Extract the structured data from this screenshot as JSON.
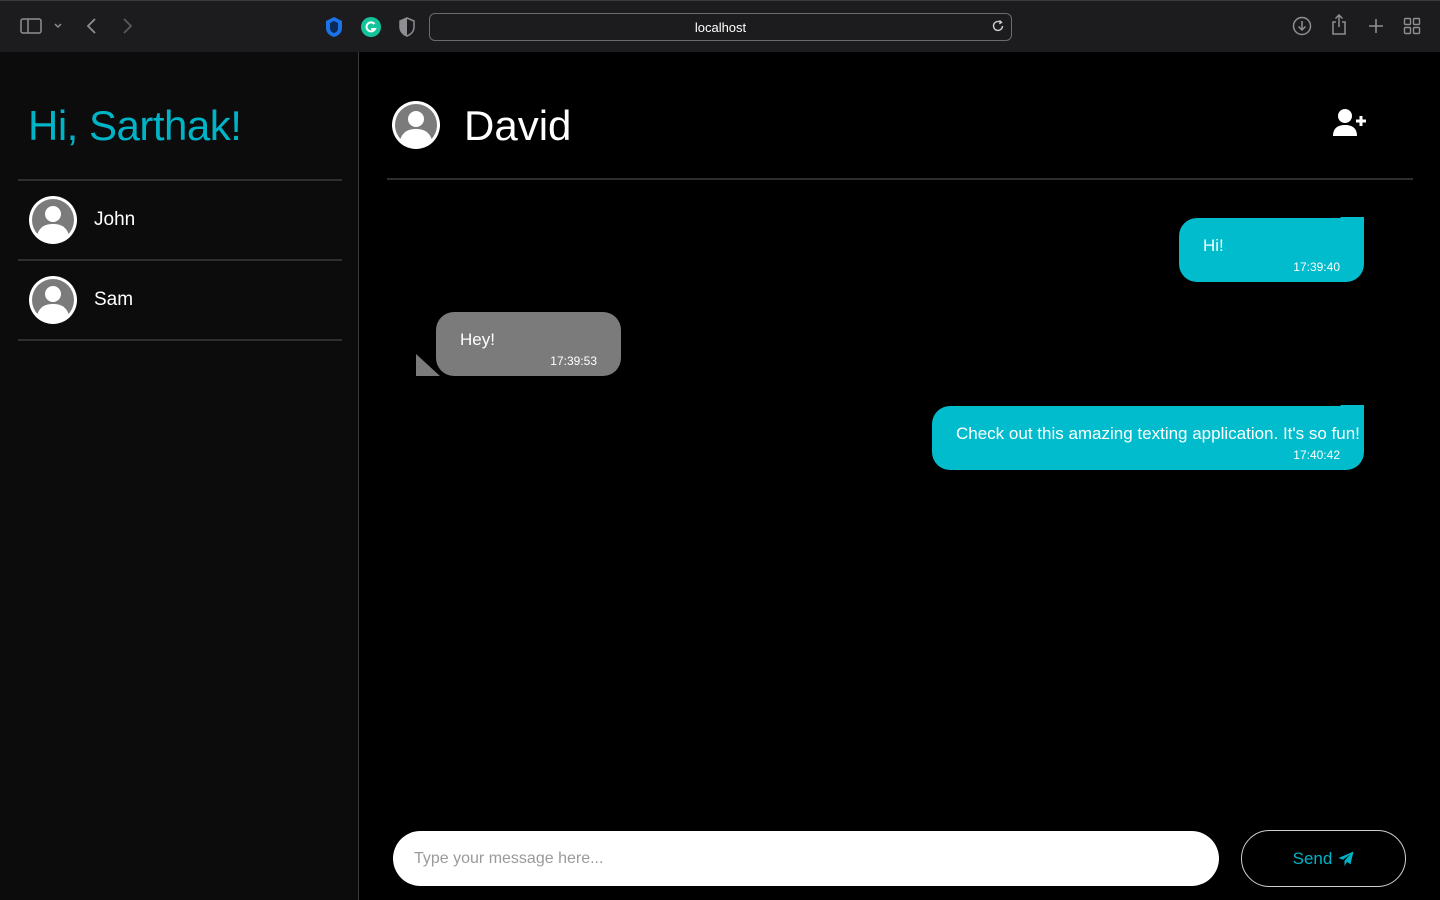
{
  "browser": {
    "url": "localhost"
  },
  "sidebar": {
    "greeting": "Hi, Sarthak!",
    "contacts": [
      {
        "name": "John"
      },
      {
        "name": "Sam"
      }
    ]
  },
  "chat": {
    "title": "David",
    "messages": [
      {
        "direction": "outgoing",
        "text": "Hi!",
        "time": "17:39:40"
      },
      {
        "direction": "incoming",
        "text": "Hey!",
        "time": "17:39:53"
      },
      {
        "direction": "outgoing",
        "text": "Check out this amazing texting application. It's so fun!",
        "time": "17:40:42"
      }
    ],
    "composer_placeholder": "Type your message here...",
    "send_label": "Send"
  },
  "colors": {
    "accent": "#00b4c8",
    "outgoing_bubble": "#00bccc",
    "incoming_bubble": "#7b7b7b"
  }
}
